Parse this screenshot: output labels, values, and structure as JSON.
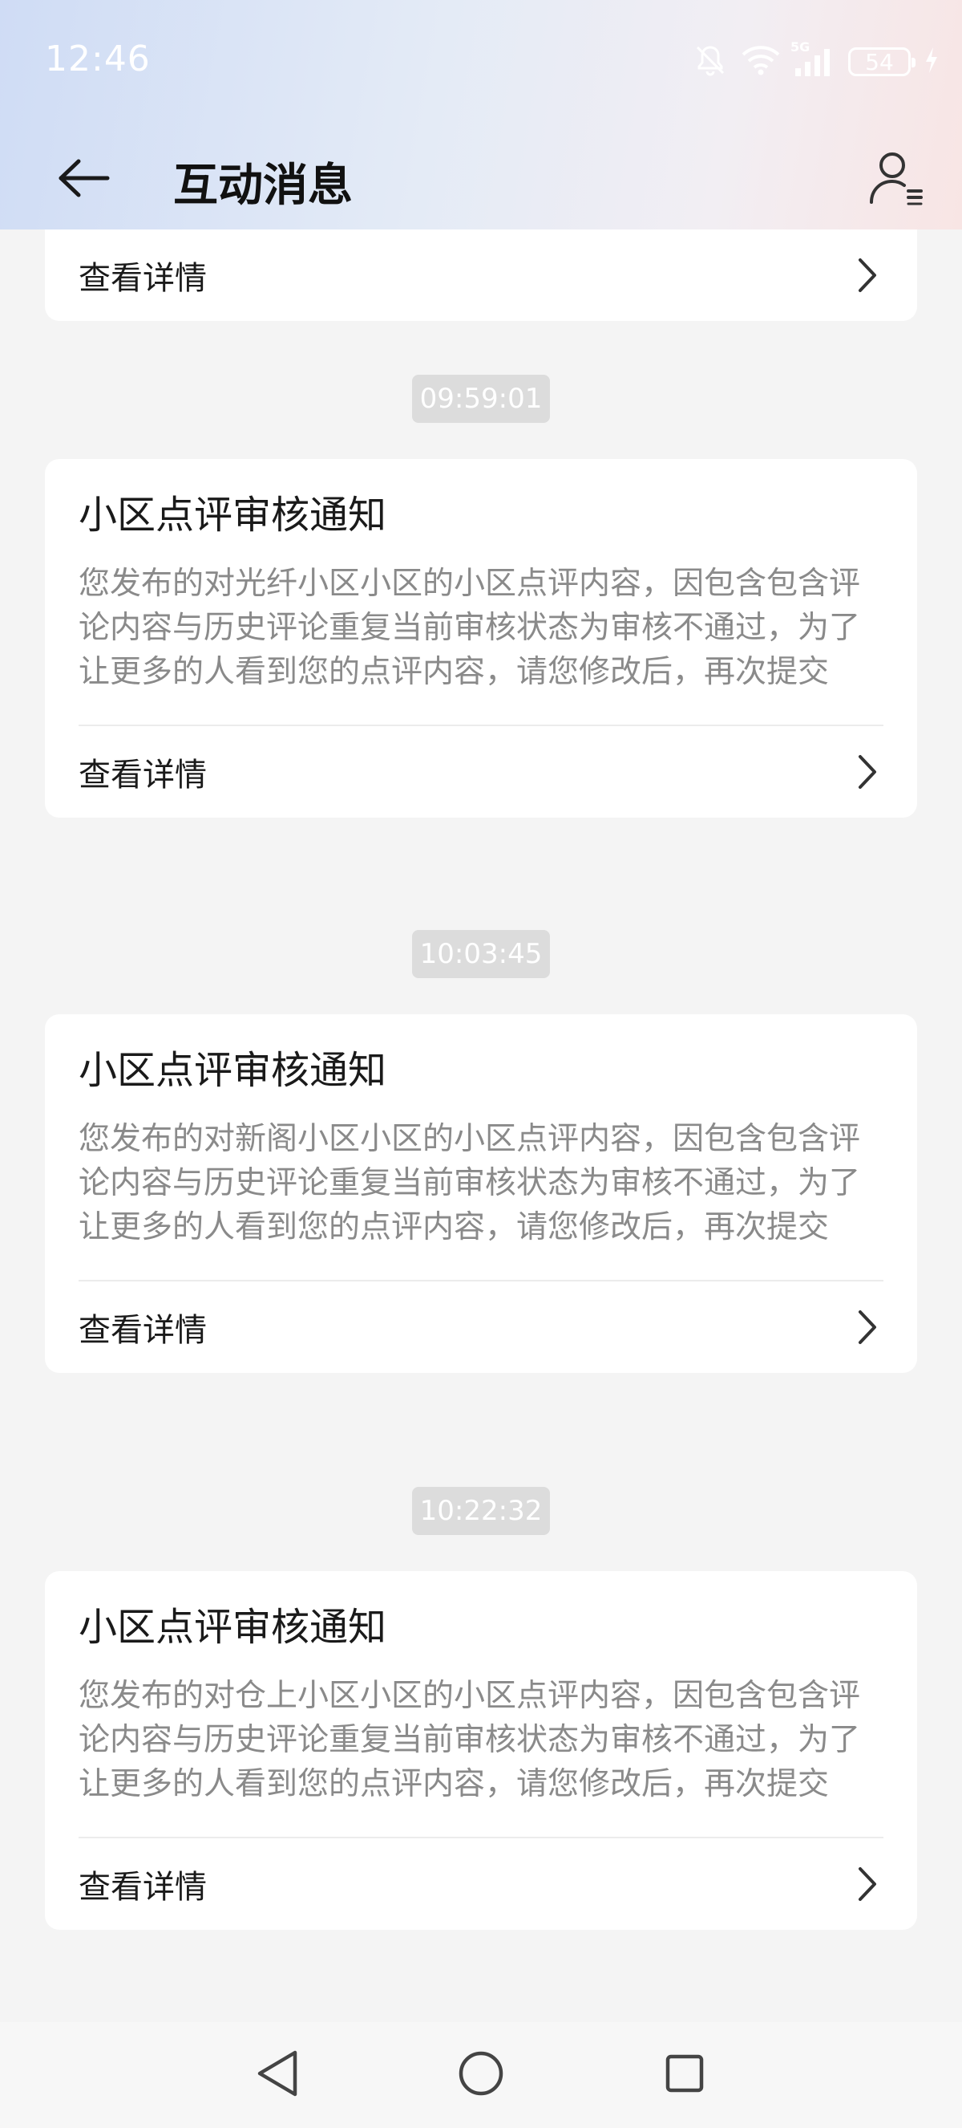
{
  "status_bar": {
    "time": "12:46",
    "network": "5G",
    "battery": "54",
    "icons": [
      "bell-muted-icon",
      "wifi-icon",
      "signal-icon",
      "battery-icon",
      "charging-bolt-icon"
    ]
  },
  "header": {
    "title": "互动消息",
    "back_icon": "arrow-left-icon",
    "profile_icon": "user-list-icon"
  },
  "messages": [
    {
      "partial": true,
      "detail_label": "查看详情"
    },
    {
      "timestamp": "09:59:01",
      "title": "小区点评审核通知",
      "body": "您发布的对光纤小区小区的小区点评内容，因包含包含评论内容与历史评论重复当前审核状态为审核不通过，为了让更多的人看到您的点评内容，请您修改后，再次提交",
      "detail_label": "查看详情"
    },
    {
      "timestamp": "10:03:45",
      "title": "小区点评审核通知",
      "body": "您发布的对新阁小区小区的小区点评内容，因包含包含评论内容与历史评论重复当前审核状态为审核不通过，为了让更多的人看到您的点评内容，请您修改后，再次提交",
      "detail_label": "查看详情"
    },
    {
      "timestamp": "10:22:32",
      "title": "小区点评审核通知",
      "body": "您发布的对仓上小区小区的小区点评内容，因包含包含评论内容与历史评论重复当前审核状态为审核不通过，为了让更多的人看到您的点评内容，请您修改后，再次提交",
      "detail_label": "查看详情"
    }
  ],
  "nav_bar": {
    "buttons": [
      "back-triangle-icon",
      "home-circle-icon",
      "recents-square-icon"
    ]
  }
}
